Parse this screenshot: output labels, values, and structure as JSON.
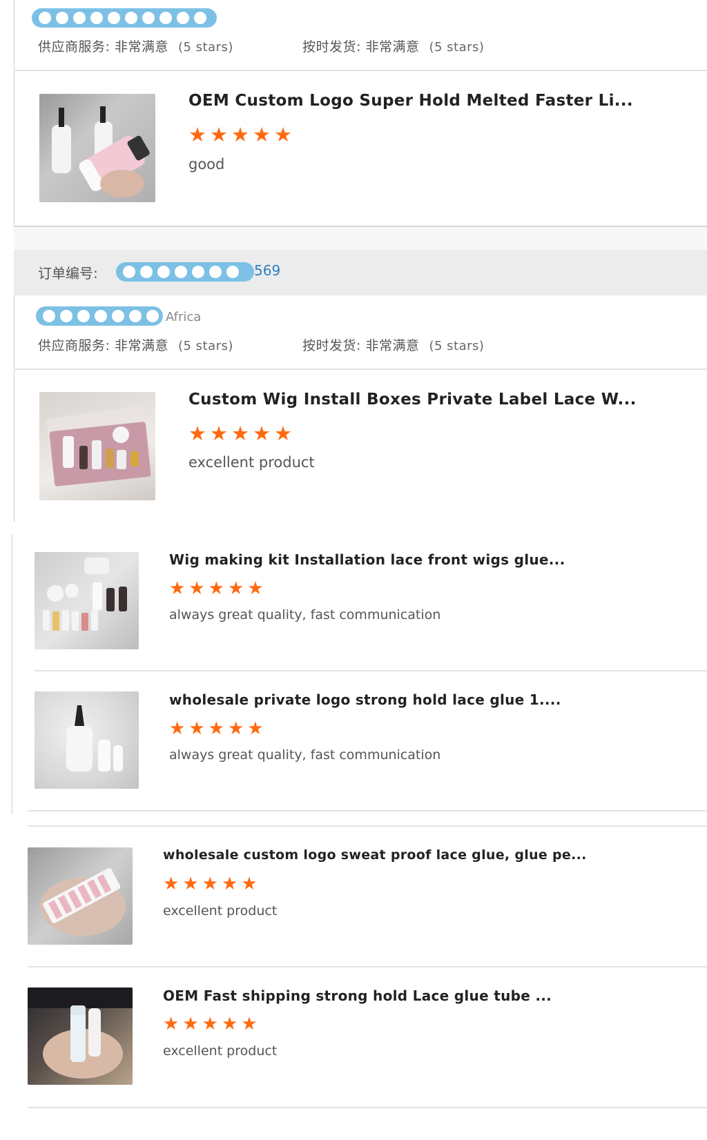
{
  "labels": {
    "supplier_service": "供应商服务: 非常满意",
    "on_time_shipping": "按时发货: 非常满意",
    "five_stars": "(5 stars)",
    "order_number": "订单编号:",
    "order_number_tail": "569",
    "region": "Africa"
  },
  "reviews": [
    {
      "title": "OEM Custom Logo Super Hold Melted Faster Li...",
      "stars": 5,
      "text": "good"
    },
    {
      "title": "Custom Wig Install Boxes Private Label Lace W...",
      "stars": 5,
      "text": "excellent product"
    },
    {
      "title": "Wig making kit Installation lace front wigs glue...",
      "stars": 5,
      "text": "always great quality, fast communication"
    },
    {
      "title": "wholesale private logo strong hold lace glue 1....",
      "stars": 5,
      "text": "always great quality, fast communication"
    },
    {
      "title": "wholesale custom logo sweat proof lace glue, glue pe...",
      "stars": 5,
      "text": "excellent product"
    },
    {
      "title": "OEM Fast shipping strong hold Lace glue tube ...",
      "stars": 5,
      "text": "excellent product"
    }
  ],
  "colors": {
    "star": "#ff6a10",
    "link": "#2c7fc1",
    "redaction": "#7cc0e6"
  }
}
